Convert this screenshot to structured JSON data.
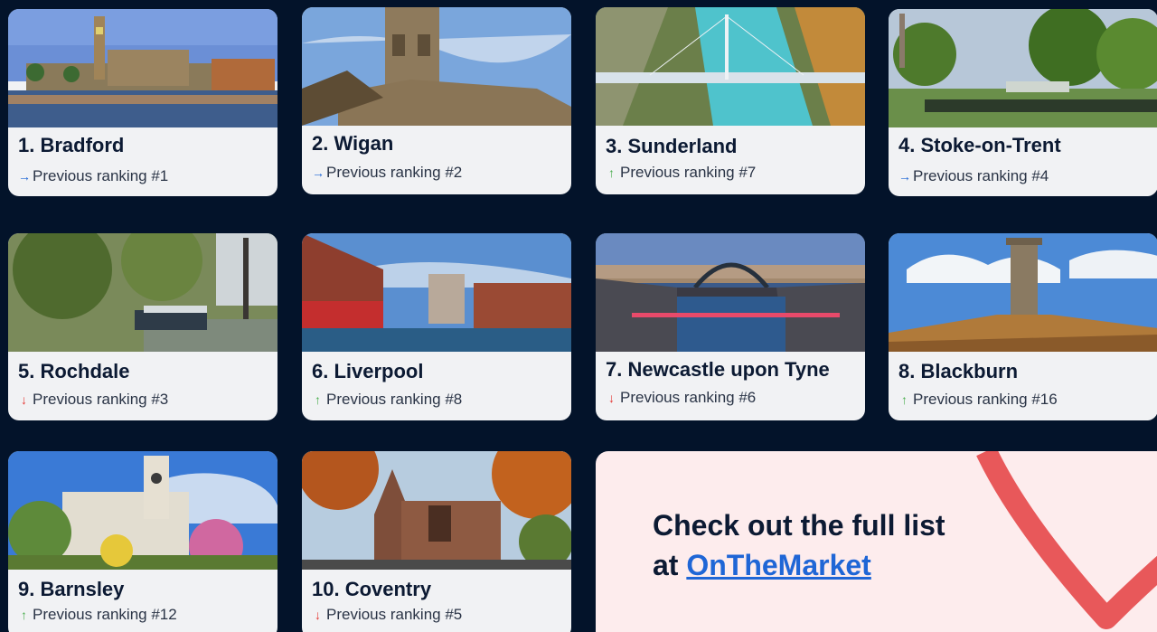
{
  "cards": [
    {
      "title": "1. Bradford",
      "prev": "Previous ranking #1",
      "trend": "same",
      "arrow": "→"
    },
    {
      "title": "2. Wigan",
      "prev": "Previous ranking #2",
      "trend": "same",
      "arrow": "→"
    },
    {
      "title": "3. Sunderland",
      "prev": "Previous ranking #7",
      "trend": "up",
      "arrow": "↑"
    },
    {
      "title": "4. Stoke-on-Trent",
      "prev": "Previous ranking #4",
      "trend": "same",
      "arrow": "→"
    },
    {
      "title": "5. Rochdale",
      "prev": "Previous ranking #3",
      "trend": "down",
      "arrow": "↓"
    },
    {
      "title": "6. Liverpool",
      "prev": "Previous ranking #8",
      "trend": "up",
      "arrow": "↑"
    },
    {
      "title": "7. Newcastle upon Tyne",
      "prev": "Previous ranking #6",
      "trend": "down",
      "arrow": "↓"
    },
    {
      "title": "8. Blackburn",
      "prev": "Previous ranking #16",
      "trend": "up",
      "arrow": "↑"
    },
    {
      "title": "9. Barnsley",
      "prev": "Previous ranking #12",
      "trend": "up",
      "arrow": "↑"
    },
    {
      "title": "10. Coventry",
      "prev": "Previous ranking #5",
      "trend": "down",
      "arrow": "↓"
    }
  ],
  "cta": {
    "line1": "Check out the full list",
    "line2_prefix": "at ",
    "link_text": "OnTheMarket"
  },
  "colors": {
    "background": "#03132a",
    "card": "#f1f2f4",
    "cta_bg": "#fdeced",
    "heart": "#e8585a",
    "link": "#1f66d6",
    "arrow_same": "#1f66d6",
    "arrow_up": "#4caf50",
    "arrow_down": "#e53935"
  }
}
